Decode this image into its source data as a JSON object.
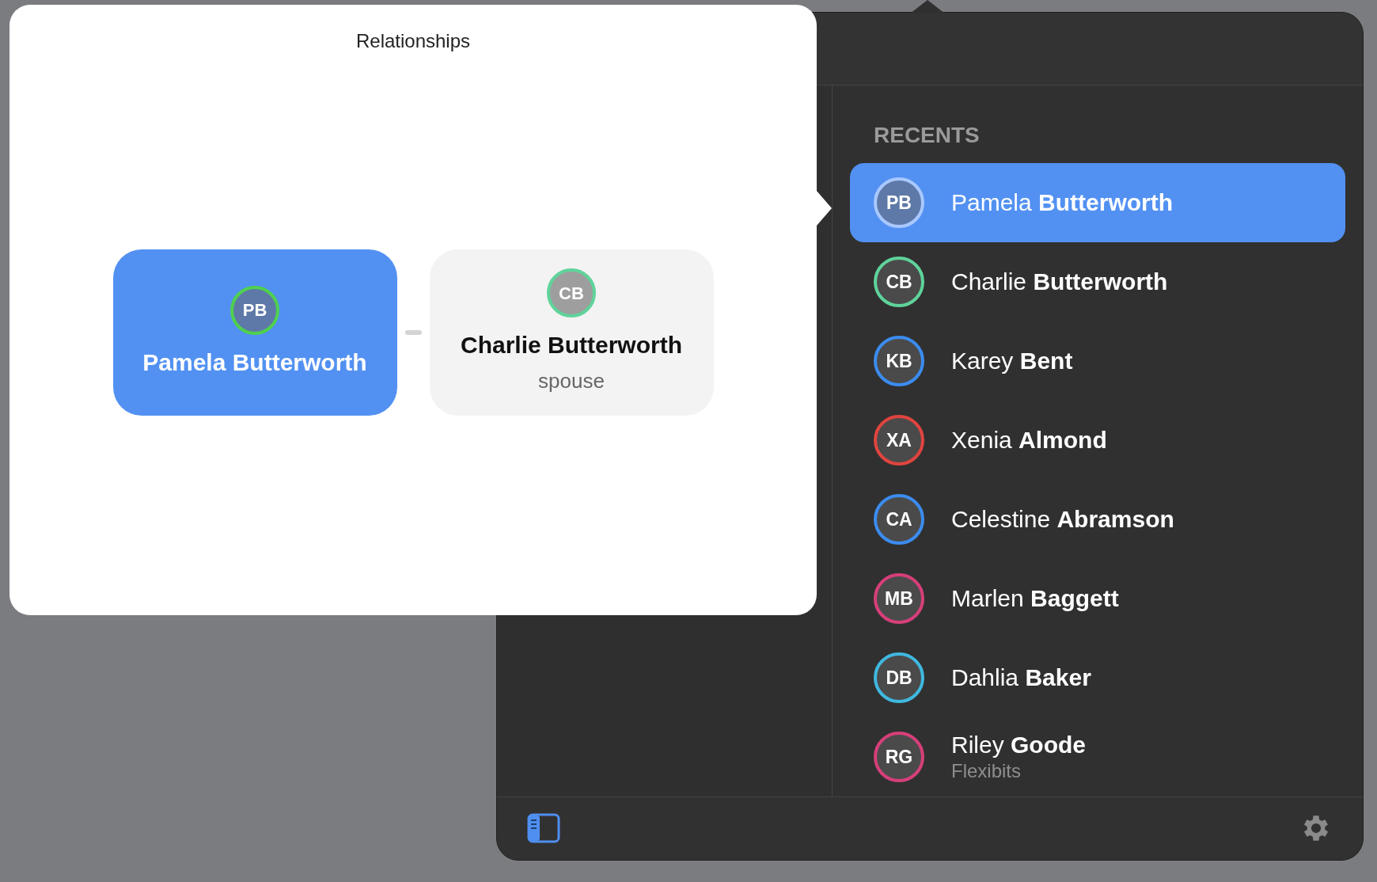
{
  "popover": {
    "title": "Relationships",
    "cards": [
      {
        "initials": "PB",
        "name": "Pamela Butterworth",
        "selected": true,
        "color": "#4fd04f"
      },
      {
        "initials": "CB",
        "name": "Charlie Butterworth",
        "relation": "spouse",
        "selected": false,
        "color": "#5fd39a"
      }
    ]
  },
  "sidebar": {
    "header": "RECENTS",
    "items": [
      {
        "initials": "PB",
        "first": "Pamela",
        "last": "Butterworth",
        "selected": true,
        "color": "#a9c8ff"
      },
      {
        "initials": "CB",
        "first": "Charlie",
        "last": "Butterworth",
        "selected": false,
        "color": "#5fd39a"
      },
      {
        "initials": "KB",
        "first": "Karey",
        "last": "Bent",
        "selected": false,
        "color": "#3b8cf0"
      },
      {
        "initials": "XA",
        "first": "Xenia",
        "last": "Almond",
        "selected": false,
        "color": "#e0443f"
      },
      {
        "initials": "CA",
        "first": "Celestine",
        "last": "Abramson",
        "selected": false,
        "color": "#3b8cf0"
      },
      {
        "initials": "MB",
        "first": "Marlen",
        "last": "Baggett",
        "selected": false,
        "color": "#d63f7a"
      },
      {
        "initials": "DB",
        "first": "Dahlia",
        "last": "Baker",
        "selected": false,
        "color": "#3fb8e0"
      },
      {
        "initials": "RG",
        "first": "Riley",
        "last": "Goode",
        "subtitle": "Flexibits",
        "selected": false,
        "color": "#d63f7a"
      }
    ]
  }
}
